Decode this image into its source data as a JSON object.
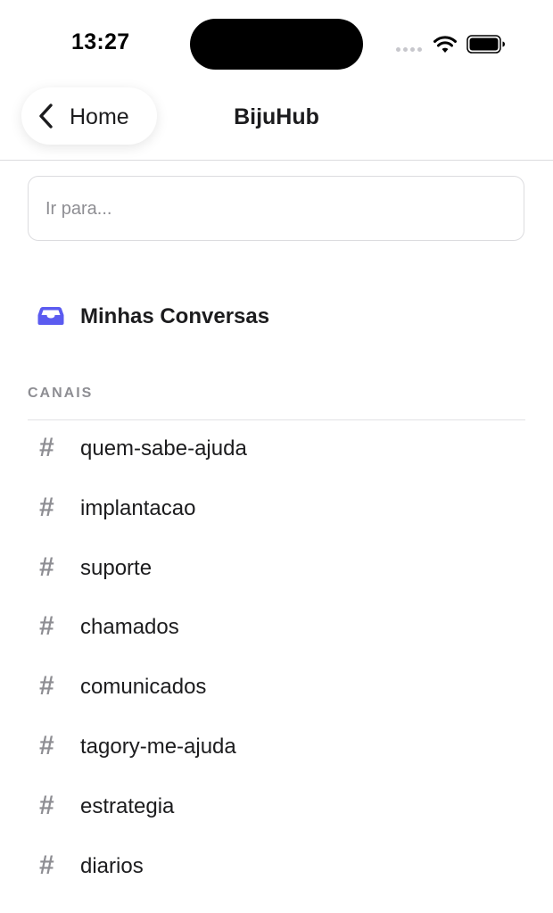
{
  "status_bar": {
    "time": "13:27"
  },
  "nav": {
    "back_label": "Home",
    "title": "BijuHub"
  },
  "search": {
    "placeholder": "Ir para..."
  },
  "my_conversations": {
    "label": "Minhas Conversas",
    "icon": "inbox-icon",
    "icon_color": "#5b5bf0"
  },
  "channels": {
    "header": "CANAIS",
    "items": [
      {
        "hash": "#",
        "name": "quem-sabe-ajuda"
      },
      {
        "hash": "#",
        "name": "implantacao"
      },
      {
        "hash": "#",
        "name": "suporte"
      },
      {
        "hash": "#",
        "name": "chamados"
      },
      {
        "hash": "#",
        "name": "comunicados"
      },
      {
        "hash": "#",
        "name": "tagory-me-ajuda"
      },
      {
        "hash": "#",
        "name": "estrategia"
      },
      {
        "hash": "#",
        "name": "diarios"
      }
    ]
  },
  "colors": {
    "accent": "#5b5bf0",
    "muted_text": "#8e8e93",
    "primary_text": "#1c1c1e",
    "divider": "#dcdcdf"
  }
}
